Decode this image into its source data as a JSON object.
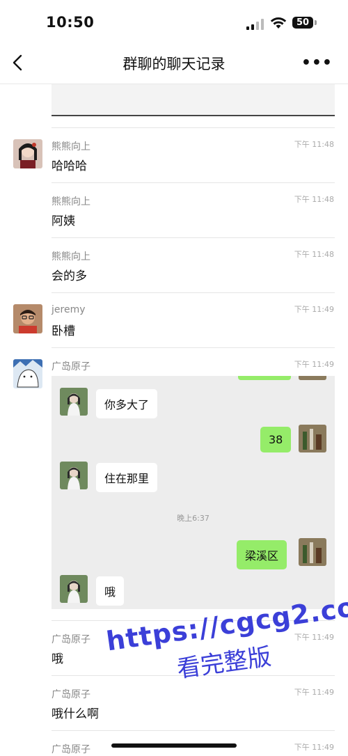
{
  "status": {
    "time": "10:50",
    "battery": "50"
  },
  "nav": {
    "title": "群聊的聊天记录",
    "more": "•••"
  },
  "messages": [
    {
      "sender": "熊熊向上",
      "time": "下午 11:48",
      "text": "哈哈哈"
    },
    {
      "sender": "熊熊向上",
      "time": "下午 11:48",
      "text": "阿姨"
    },
    {
      "sender": "熊熊向上",
      "time": "下午 11:48",
      "text": "会的多"
    },
    {
      "sender": "jeremy",
      "time": "下午 11:49",
      "text": "卧槽"
    },
    {
      "sender": "广岛原子",
      "time": "下午 11:49",
      "text": ""
    },
    {
      "sender": "广岛原子",
      "time": "下午 11:49",
      "text": "哦"
    },
    {
      "sender": "广岛原子",
      "time": "下午 11:49",
      "text": "哦什么啊"
    },
    {
      "sender": "广岛原子",
      "time": "下午 11:49",
      "text": ""
    }
  ],
  "screenshot": {
    "bubbles": [
      {
        "side": "left",
        "text": "你多大了"
      },
      {
        "side": "right",
        "text": "38"
      },
      {
        "side": "left",
        "text": "住在那里"
      },
      {
        "side": "right",
        "text": "梁溪区"
      },
      {
        "side": "left",
        "text": "哦"
      }
    ],
    "time_divider": "晚上6:37"
  },
  "watermark": {
    "url": "https://cgcg2.co",
    "text": "看完整版"
  },
  "colors": {
    "bubble_green": "#95ec69",
    "watermark": "#3b3fd8"
  }
}
